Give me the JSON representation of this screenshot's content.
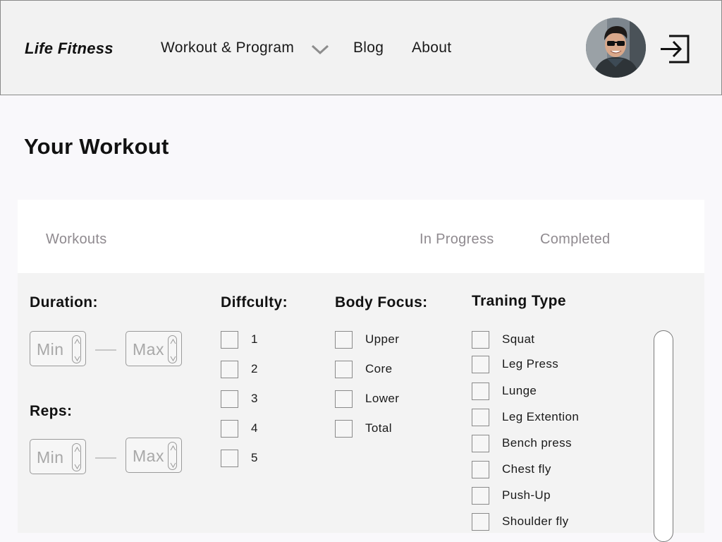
{
  "header": {
    "brand": "Life Fitness",
    "nav": {
      "workout_program": "Workout & Program",
      "blog": "Blog",
      "about": "About"
    }
  },
  "page": {
    "title": "Your Workout"
  },
  "tabs": {
    "workouts": "Workouts",
    "in_progress": "In Progress",
    "completed": "Completed"
  },
  "filters": {
    "duration": {
      "title": "Duration:",
      "min_placeholder": "Min",
      "max_placeholder": "Max"
    },
    "reps": {
      "title": "Reps:",
      "min_placeholder": "Min",
      "max_placeholder": "Max"
    },
    "difficulty": {
      "title": "Diffculty:",
      "options": [
        "1",
        "2",
        "3",
        "4",
        "5"
      ]
    },
    "body_focus": {
      "title": "Body Focus:",
      "options": [
        "Upper",
        "Core",
        "Lower",
        "Total"
      ]
    },
    "training_type": {
      "title": "Traning Type",
      "options": [
        "Squat",
        "Leg Press",
        "Lunge",
        "Leg Extention",
        "Bench press",
        "Chest fly",
        "Push-Up",
        "Shoulder fly"
      ]
    }
  }
}
